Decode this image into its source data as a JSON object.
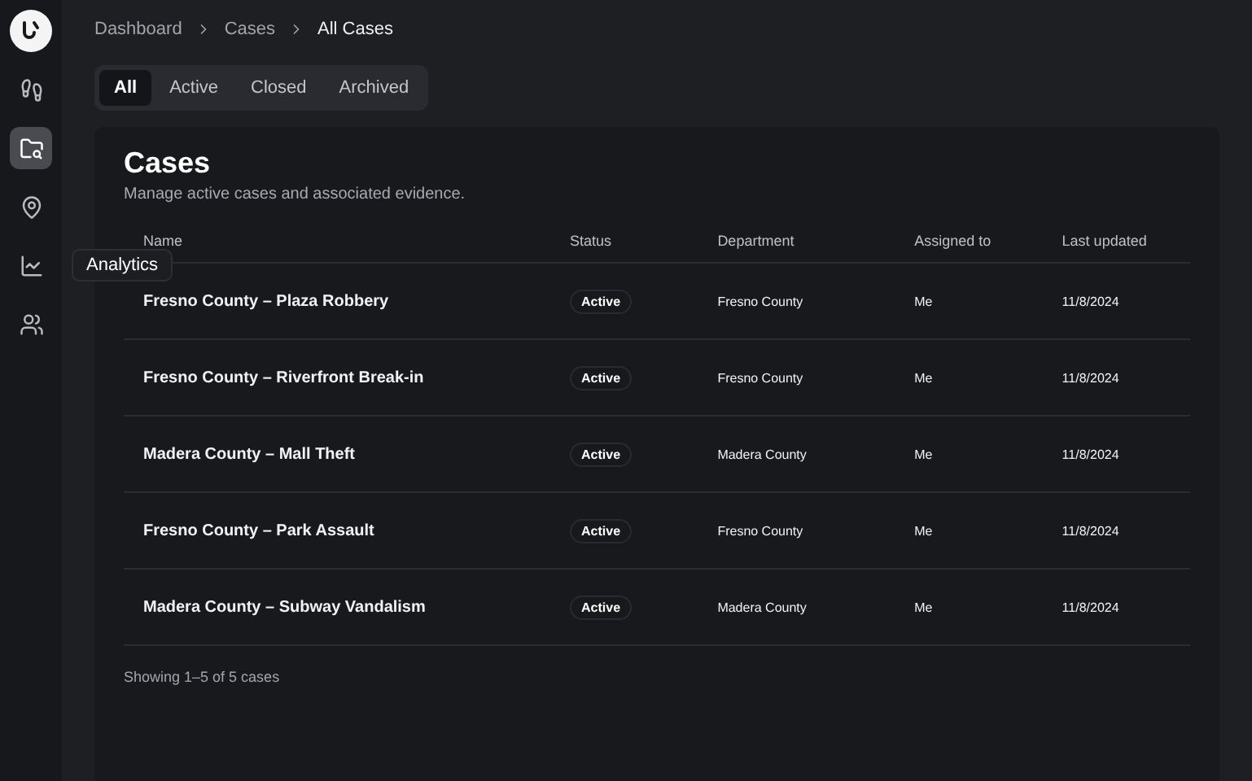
{
  "sidebar": {
    "items": [
      {
        "kind": "footprints",
        "selected": false
      },
      {
        "kind": "cases",
        "selected": true
      },
      {
        "kind": "map",
        "selected": false
      },
      {
        "kind": "analytics",
        "selected": false,
        "tooltip": "Analytics"
      },
      {
        "kind": "people",
        "selected": false
      }
    ]
  },
  "breadcrumb": [
    "Dashboard",
    "Cases",
    "All Cases"
  ],
  "tabs": [
    {
      "label": "All",
      "selected": true
    },
    {
      "label": "Active",
      "selected": false
    },
    {
      "label": "Closed",
      "selected": false
    },
    {
      "label": "Archived",
      "selected": false
    }
  ],
  "page": {
    "title": "Cases",
    "description": "Manage active cases and associated evidence."
  },
  "table": {
    "columns": [
      "Name",
      "Status",
      "Department",
      "Assigned to",
      "Last updated"
    ],
    "rows": [
      {
        "name": "Fresno County – Plaza Robbery",
        "status": "Active",
        "department": "Fresno County",
        "assigned_to": "Me",
        "last_updated": "11/8/2024"
      },
      {
        "name": "Fresno County – Riverfront Break-in",
        "status": "Active",
        "department": "Fresno County",
        "assigned_to": "Me",
        "last_updated": "11/8/2024"
      },
      {
        "name": "Madera County – Mall Theft",
        "status": "Active",
        "department": "Madera County",
        "assigned_to": "Me",
        "last_updated": "11/8/2024"
      },
      {
        "name": "Fresno County – Park Assault",
        "status": "Active",
        "department": "Fresno County",
        "assigned_to": "Me",
        "last_updated": "11/8/2024"
      },
      {
        "name": "Madera County – Subway Vandalism",
        "status": "Active",
        "department": "Madera County",
        "assigned_to": "Me",
        "last_updated": "11/8/2024"
      }
    ]
  },
  "footer": "Showing 1–5 of 5 cases"
}
